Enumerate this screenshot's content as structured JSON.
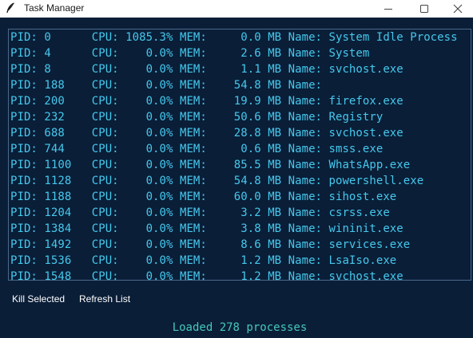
{
  "window": {
    "title": "Task Manager"
  },
  "processes": [
    {
      "text": "PID: 0      CPU: 1085.3% MEM:     0.0 MB Name: System Idle Process"
    },
    {
      "text": "PID: 4      CPU:    0.0% MEM:     2.6 MB Name: System"
    },
    {
      "text": "PID: 8      CPU:    0.0% MEM:     1.1 MB Name: svchost.exe"
    },
    {
      "text": "PID: 188    CPU:    0.0% MEM:    54.8 MB Name:"
    },
    {
      "text": "PID: 200    CPU:    0.0% MEM:    19.9 MB Name: firefox.exe"
    },
    {
      "text": "PID: 232    CPU:    0.0% MEM:    50.6 MB Name: Registry"
    },
    {
      "text": "PID: 688    CPU:    0.0% MEM:    28.8 MB Name: svchost.exe"
    },
    {
      "text": "PID: 744    CPU:    0.0% MEM:     0.6 MB Name: smss.exe"
    },
    {
      "text": "PID: 1100   CPU:    0.0% MEM:    85.5 MB Name: WhatsApp.exe"
    },
    {
      "text": "PID: 1128   CPU:    0.0% MEM:    54.8 MB Name: powershell.exe"
    },
    {
      "text": "PID: 1188   CPU:    0.0% MEM:    60.0 MB Name: sihost.exe"
    },
    {
      "text": "PID: 1204   CPU:    0.0% MEM:     3.2 MB Name: csrss.exe"
    },
    {
      "text": "PID: 1384   CPU:    0.0% MEM:     3.8 MB Name: wininit.exe"
    },
    {
      "text": "PID: 1492   CPU:    0.0% MEM:     8.6 MB Name: services.exe"
    },
    {
      "text": "PID: 1536   CPU:    0.0% MEM:     1.2 MB Name: LsaIso.exe"
    },
    {
      "text": "PID: 1548   CPU:    0.0% MEM:     1.2 MB Name: svchost.exe"
    }
  ],
  "buttons": {
    "kill_label": "Kill Selected",
    "refresh_label": "Refresh List"
  },
  "status": {
    "text": "Loaded 278 processes"
  },
  "icons": {
    "app": "feather-icon",
    "minimize": "minimize-icon",
    "maximize": "maximize-icon",
    "close": "close-icon"
  },
  "colors": {
    "background": "#0a1e38",
    "list_text": "#46c8ec",
    "status_text": "#46c8bc",
    "list_border": "#4a6a8a",
    "button_text": "#ffffff"
  }
}
